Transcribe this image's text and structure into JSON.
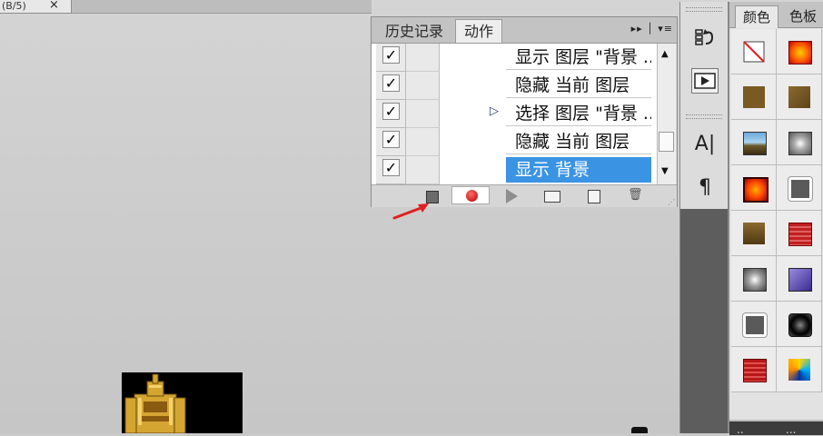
{
  "document": {
    "tab_fragment": "(B/5)",
    "close_symbol": "×"
  },
  "actions_panel": {
    "tabs": [
      {
        "label": "历史记录"
      },
      {
        "label": "动作"
      }
    ],
    "menu_symbol": "▸▸ │ ▾≡",
    "rows": [
      {
        "checked": true,
        "text": "显示 图层 \"背景 ...",
        "selected": false,
        "expanded_marker": false
      },
      {
        "checked": true,
        "text": "隐藏 当前 图层",
        "selected": false,
        "expanded_marker": false
      },
      {
        "checked": true,
        "text": "选择 图层 \"背景 ...",
        "selected": false,
        "expanded_marker": true
      },
      {
        "checked": true,
        "text": "隐藏 当前 图层",
        "selected": false,
        "expanded_marker": false
      },
      {
        "checked": true,
        "text": "显示 背景",
        "selected": true,
        "expanded_marker": false
      }
    ],
    "check_glyph": "✓",
    "expand_glyph": "▷",
    "bottom_buttons": [
      "stop-recording",
      "begin-recording",
      "play-selection",
      "create-new-set",
      "create-new-action",
      "delete"
    ],
    "selection_color": "#3b93e3"
  },
  "tool_strip": {
    "tools": [
      {
        "name": "history-icon",
        "glyph": "⁑"
      },
      {
        "name": "actions-play-icon",
        "glyph": "▶"
      },
      {
        "name": "character-icon",
        "glyph": "A|"
      },
      {
        "name": "paragraph-icon",
        "glyph": "¶"
      }
    ]
  },
  "styles_panel": {
    "tabs": [
      {
        "label": "颜色"
      },
      {
        "label": "色板"
      }
    ],
    "bottom_tabs": [
      {
        "label": ".."
      },
      {
        "label": "..."
      }
    ],
    "swatches": [
      "none",
      "orange-glow",
      "brown-flat",
      "brown-flat",
      "sky-landscape",
      "sparkle-gray",
      "orange-glow",
      "gray-outline",
      "brown-gradient",
      "red-stripe",
      "sparkle-gray",
      "blue-bevel",
      "gray-outline",
      "chrome-circle",
      "red-stripe",
      "rainbow-dash"
    ]
  }
}
